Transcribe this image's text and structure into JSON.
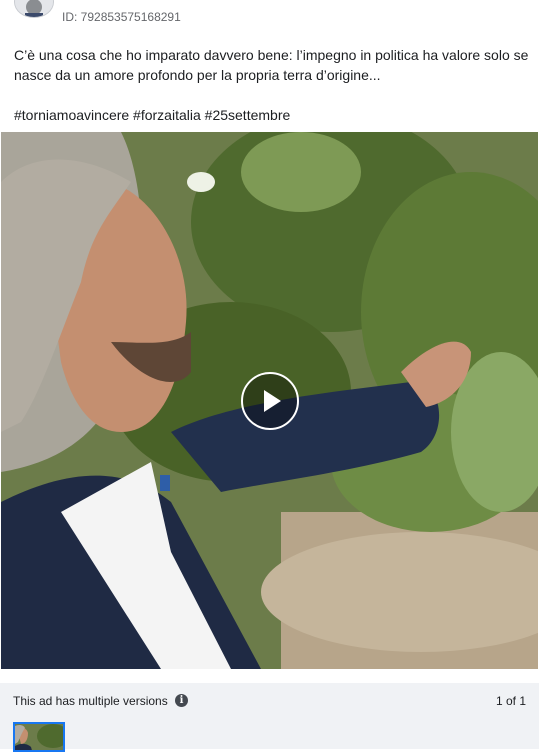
{
  "header": {
    "ad_id": "ID: 792853575168291"
  },
  "post": {
    "text": "C’è una cosa che ho imparato davvero bene: l’impegno in politica ha valore solo se nasce da un amore profondo per la propria terra d’origine...",
    "hashtags": "#torniamoavincere #forzaitalia #25settembre"
  },
  "media": {
    "type": "video",
    "play_icon": "play-icon"
  },
  "footer": {
    "versions_label": "This ad has multiple versions",
    "info_icon": "info-icon",
    "info_glyph": "i",
    "pager": "1 of 1"
  },
  "colors": {
    "footer_bg": "#f0f2f5",
    "thumbnail_border": "#1877f2",
    "secondary_text": "#65676b"
  }
}
